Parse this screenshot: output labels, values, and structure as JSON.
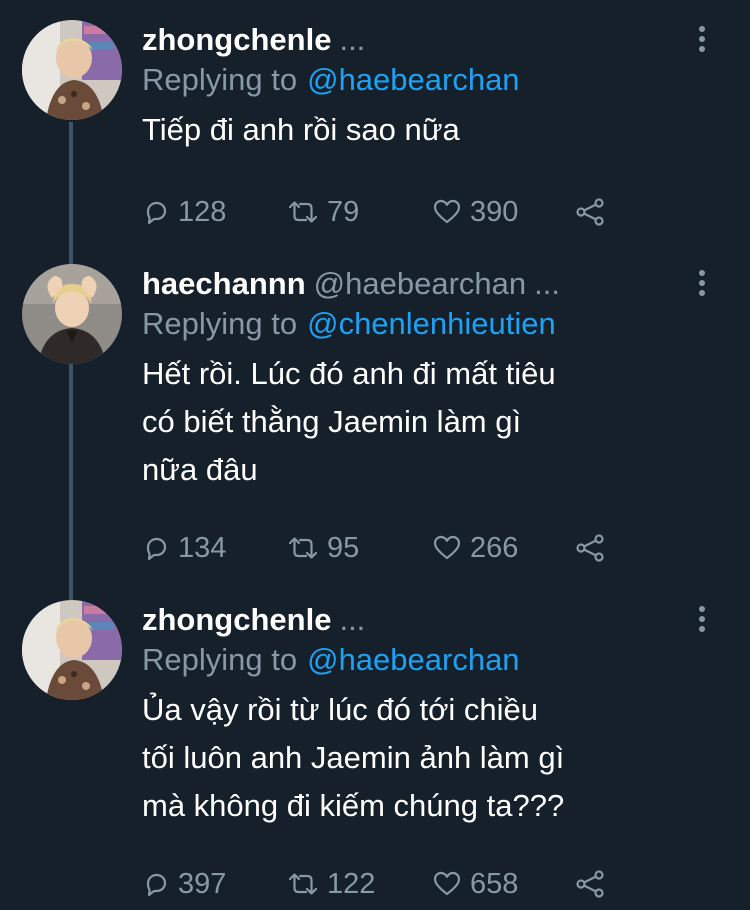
{
  "tweets": [
    {
      "name": "zhongchenle",
      "handle": "",
      "header_ellipsis": "...",
      "replying_prefix": "Replying to",
      "replying_to": "@haebearchan",
      "text_lines": [
        "Tiếp đi anh rồi sao nữa"
      ],
      "replies": "128",
      "retweets": "79",
      "likes": "390"
    },
    {
      "name": "haechannn",
      "handle": "@haebearchan",
      "header_ellipsis": "...",
      "replying_prefix": "Replying to",
      "replying_to": "@chenlenhieutien",
      "text_lines": [
        "Hết rồi. Lúc đó anh đi mất tiêu",
        "có biết thằng Jaemin làm gì",
        "nữa đâu"
      ],
      "replies": "134",
      "retweets": "95",
      "likes": "266"
    },
    {
      "name": "zhongchenle",
      "handle": "",
      "header_ellipsis": "...",
      "replying_prefix": "Replying to",
      "replying_to": "@haebearchan",
      "text_lines": [
        "Ủa vậy rồi từ lúc đó tới chiều",
        "tối luôn anh Jaemin ảnh làm gì",
        "mà không đi kiếm chúng ta???"
      ],
      "replies": "397",
      "retweets": "122",
      "likes": "658"
    }
  ],
  "icons": {
    "reply": "reply-icon",
    "retweet": "retweet-icon",
    "like": "heart-icon",
    "share": "share-icon",
    "more": "more-icon"
  },
  "colors": {
    "background": "#15202b",
    "text": "#ffffff",
    "secondary": "#8899a6",
    "mention": "#1da1f2",
    "thread_line": "#3d5466"
  }
}
